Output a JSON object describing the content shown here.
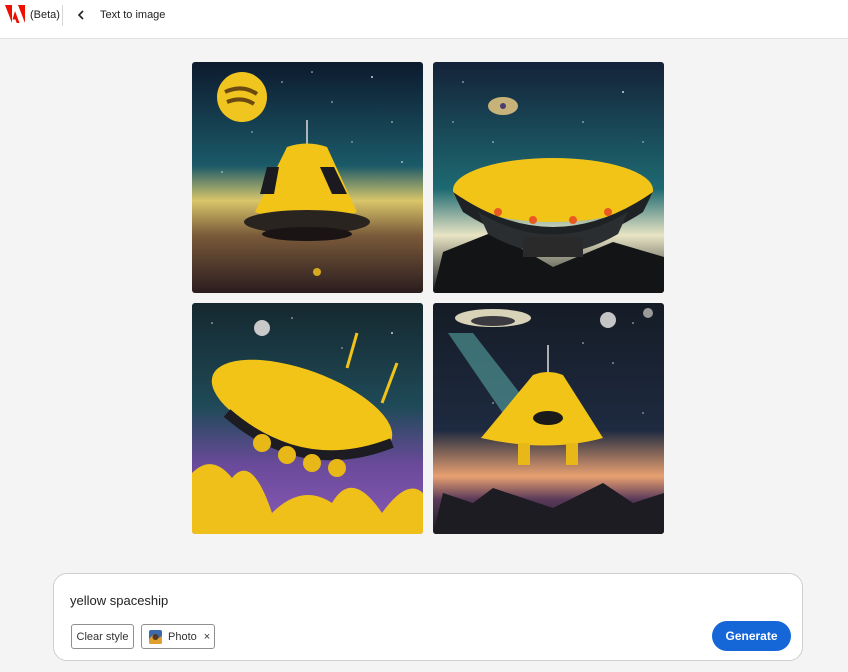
{
  "header": {
    "beta_label": "(Beta)",
    "page_title": "Text to image"
  },
  "gallery": {
    "images": [
      {
        "subject": "yellow capsule spaceship with moon"
      },
      {
        "subject": "yellow saucer spaceship over dark landscape"
      },
      {
        "subject": "yellow saucer with thrusters over purple sky"
      },
      {
        "subject": "yellow domed ship with beam of light"
      }
    ]
  },
  "prompt": {
    "value": "yellow spaceship",
    "clear_style_label": "Clear style",
    "style_chip_label": "Photo",
    "style_chip_remove": "×",
    "generate_label": "Generate"
  },
  "colors": {
    "brand_red": "#eb1000",
    "accent_blue": "#1566d6",
    "ship_yellow": "#f2c418"
  }
}
